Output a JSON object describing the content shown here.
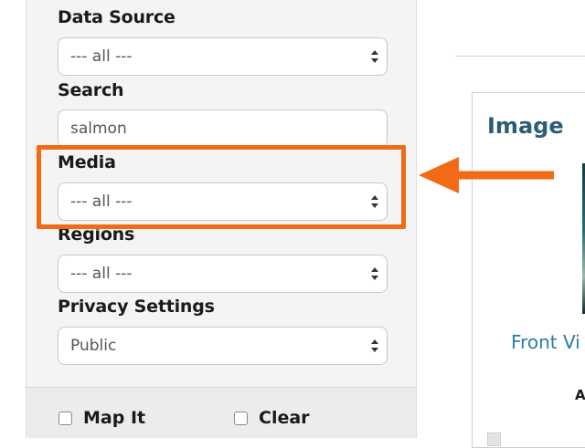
{
  "sidebar": {
    "data_source": {
      "label": "Data Source",
      "value": "--- all ---"
    },
    "search": {
      "label": "Search",
      "value": "salmon"
    },
    "media": {
      "label": "Media",
      "value": "--- all ---"
    },
    "regions": {
      "label": "Regions",
      "value": "--- all ---"
    },
    "privacy": {
      "label": "Privacy Settings",
      "value": "Public"
    },
    "map_it_label": "Map It",
    "clear_label": "Clear"
  },
  "main": {
    "card": {
      "title": "Image",
      "link": "Front Vi",
      "letter": "A"
    }
  },
  "colors": {
    "highlight": "#f26a16",
    "title": "#2c5d73",
    "link": "#2a7da6"
  }
}
